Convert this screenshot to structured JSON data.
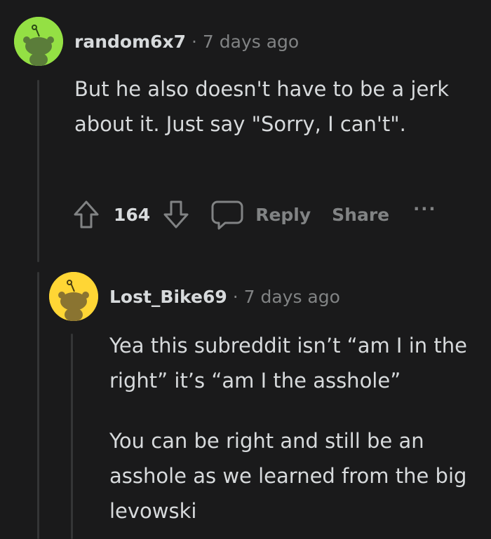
{
  "comments": [
    {
      "username": "random6x7",
      "separator": "·",
      "time": "7 days ago",
      "avatar_color": "#94e044",
      "paragraphs": [
        "But he also doesn't have to be a jerk about it. Just say \"Sorry, I can't\"."
      ],
      "votes": "164",
      "reply_label": "Reply",
      "share_label": "Share",
      "more_label": "···"
    },
    {
      "username": "Lost_Bike69",
      "separator": "·",
      "time": "7 days ago",
      "avatar_color": "#ffd635",
      "paragraphs": [
        "Yea this subreddit isn’t “am I in the right” it’s “am I the asshole”",
        "You can be right and still be an asshole as we learned from the big levowski"
      ]
    }
  ],
  "theme": {
    "background": "#1a1a1b",
    "text": "#d7dadc",
    "meta": "#818384",
    "thread_line": "#343536"
  }
}
